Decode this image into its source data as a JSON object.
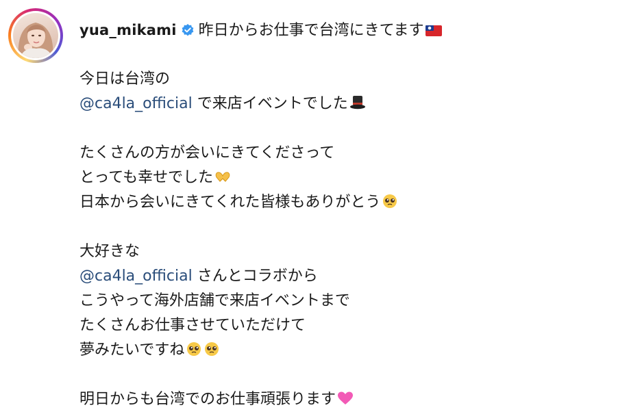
{
  "post": {
    "username": "yua_mikami",
    "verified_icon": "verified-badge-icon",
    "header_text": "昨日からお仕事で台湾にきてます",
    "header_emoji": "taiwan-flag-icon",
    "para1": {
      "line1": "今日は台湾の",
      "line2_mention": "@ca4la_official",
      "line2_text": " で来店イベントでした",
      "line2_emoji": "top-hat-icon"
    },
    "para2": {
      "line1": "たくさんの方が会いにきてくださって",
      "line2": "とっても幸せでした",
      "line2_emoji": "heart-hands-icon",
      "line3": "日本から会いにきてくれた皆様もありがとう",
      "line3_emoji": "pleading-face-icon"
    },
    "para3": {
      "line1": "大好きな",
      "line2_mention": "@ca4la_official",
      "line2_text": " さんとコラボから",
      "line3": "こうやって海外店舗で来店イベントまで",
      "line4": "たくさんお仕事させていただけて",
      "line5": "夢みたいですね",
      "line5_emoji": "pleading-face-icon"
    },
    "para4": {
      "line1": "明日からも台湾でのお仕事頑張ります",
      "line1_emoji": "pink-heart-icon"
    }
  },
  "colors": {
    "mention": "#2a4d7a",
    "verified": "#3897f0",
    "text": "#1a1a1a"
  }
}
